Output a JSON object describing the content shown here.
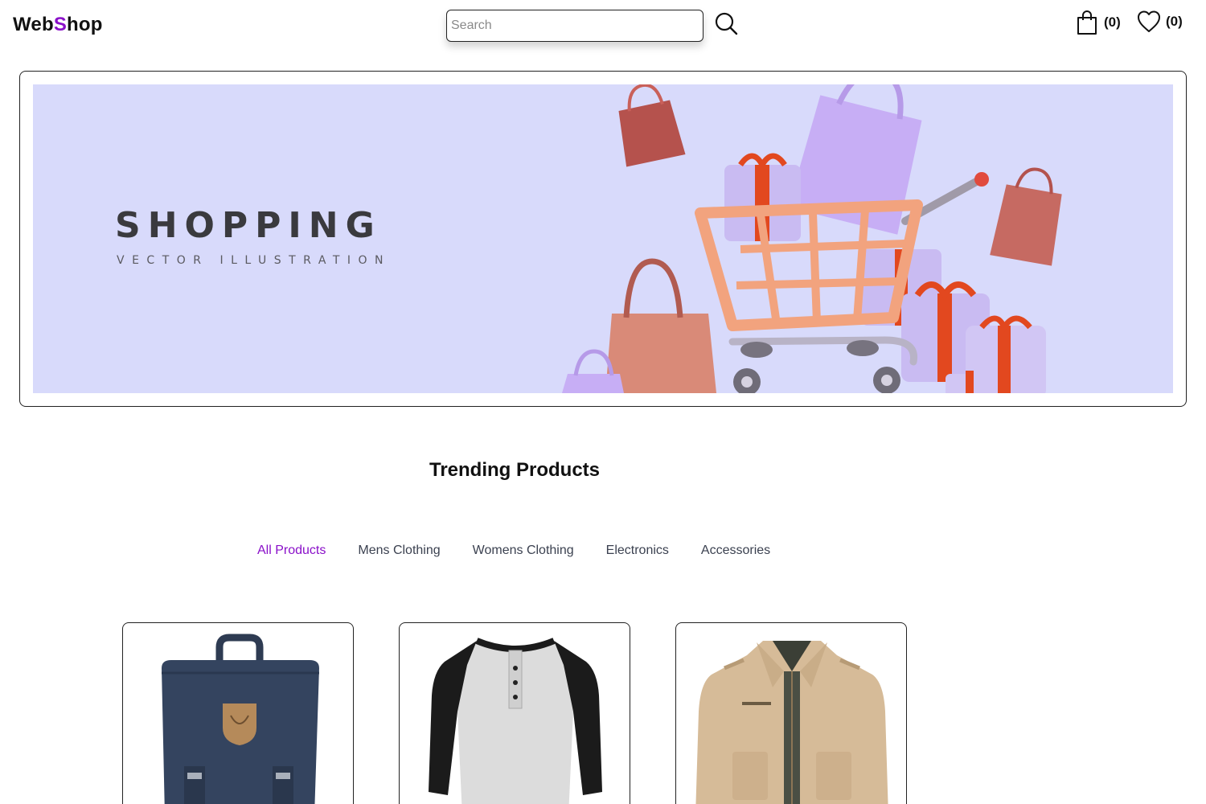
{
  "header": {
    "logo_part1": "Web",
    "logo_part2": "S",
    "logo_part3": "hop",
    "search_placeholder": "Search",
    "search_icon": "search-icon",
    "cart_icon": "shopping-bag-icon",
    "cart_count": "(0)",
    "wishlist_icon": "heart-icon",
    "wishlist_count": "(0)"
  },
  "banner": {
    "title": "SHOPPING",
    "subtitle": "VECTOR ILLUSTRATION",
    "background_color": "#d8dafb"
  },
  "trending": {
    "title": "Trending Products",
    "tabs": [
      {
        "label": "All Products",
        "active": true
      },
      {
        "label": "Mens Clothing",
        "active": false
      },
      {
        "label": "Womens Clothing",
        "active": false
      },
      {
        "label": "Electronics",
        "active": false
      },
      {
        "label": "Accessories",
        "active": false
      }
    ]
  },
  "products": [
    {
      "image": "navy-backpack"
    },
    {
      "image": "raglan-henley-shirt"
    },
    {
      "image": "khaki-jacket"
    }
  ],
  "colors": {
    "accent": "#8a10c9",
    "tab_text": "#3b4150"
  }
}
